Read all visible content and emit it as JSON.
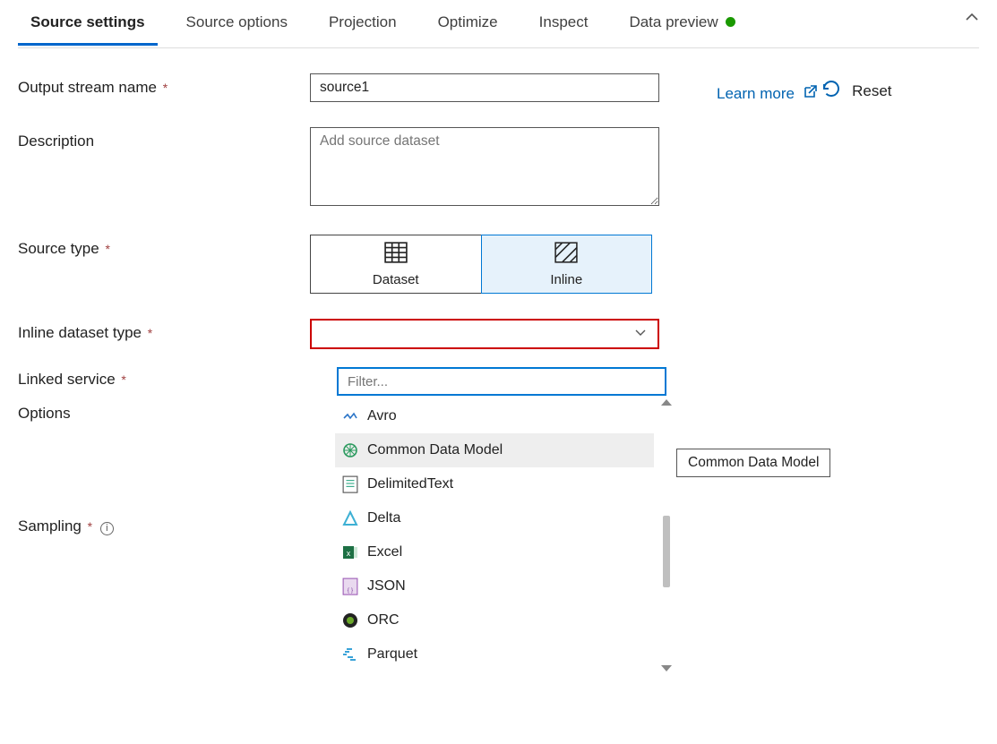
{
  "tabs": [
    {
      "label": "Source settings",
      "active": true
    },
    {
      "label": "Source options",
      "active": false
    },
    {
      "label": "Projection",
      "active": false
    },
    {
      "label": "Optimize",
      "active": false
    },
    {
      "label": "Inspect",
      "active": false
    },
    {
      "label": "Data preview",
      "active": false,
      "indicator": "green"
    }
  ],
  "form": {
    "output_stream_name": {
      "label": "Output stream name",
      "required": true,
      "value": "source1"
    },
    "description": {
      "label": "Description",
      "required": false,
      "placeholder": "Add source dataset",
      "value": ""
    },
    "source_type": {
      "label": "Source type",
      "required": true,
      "options": [
        {
          "label": "Dataset",
          "icon": "grid-icon",
          "selected": false
        },
        {
          "label": "Inline",
          "icon": "hatch-icon",
          "selected": true
        }
      ]
    },
    "inline_dataset_type": {
      "label": "Inline dataset type",
      "required": true,
      "value": "",
      "filter_placeholder": "Filter...",
      "options": [
        {
          "label": "Avro",
          "icon": "avro-icon",
          "hovered": false
        },
        {
          "label": "Common Data Model",
          "icon": "cdm-icon",
          "hovered": true
        },
        {
          "label": "DelimitedText",
          "icon": "csv-icon",
          "hovered": false
        },
        {
          "label": "Delta",
          "icon": "delta-icon",
          "hovered": false
        },
        {
          "label": "Excel",
          "icon": "excel-icon",
          "hovered": false
        },
        {
          "label": "JSON",
          "icon": "json-icon",
          "hovered": false
        },
        {
          "label": "ORC",
          "icon": "orc-icon",
          "hovered": false
        },
        {
          "label": "Parquet",
          "icon": "parquet-icon",
          "hovered": false
        }
      ]
    },
    "linked_service": {
      "label": "Linked service",
      "required": true
    },
    "options": {
      "label": "Options",
      "required": false
    },
    "sampling": {
      "label": "Sampling",
      "required": true
    }
  },
  "side": {
    "learn_more": "Learn more",
    "reset": "Reset"
  },
  "tooltip": "Common Data Model"
}
